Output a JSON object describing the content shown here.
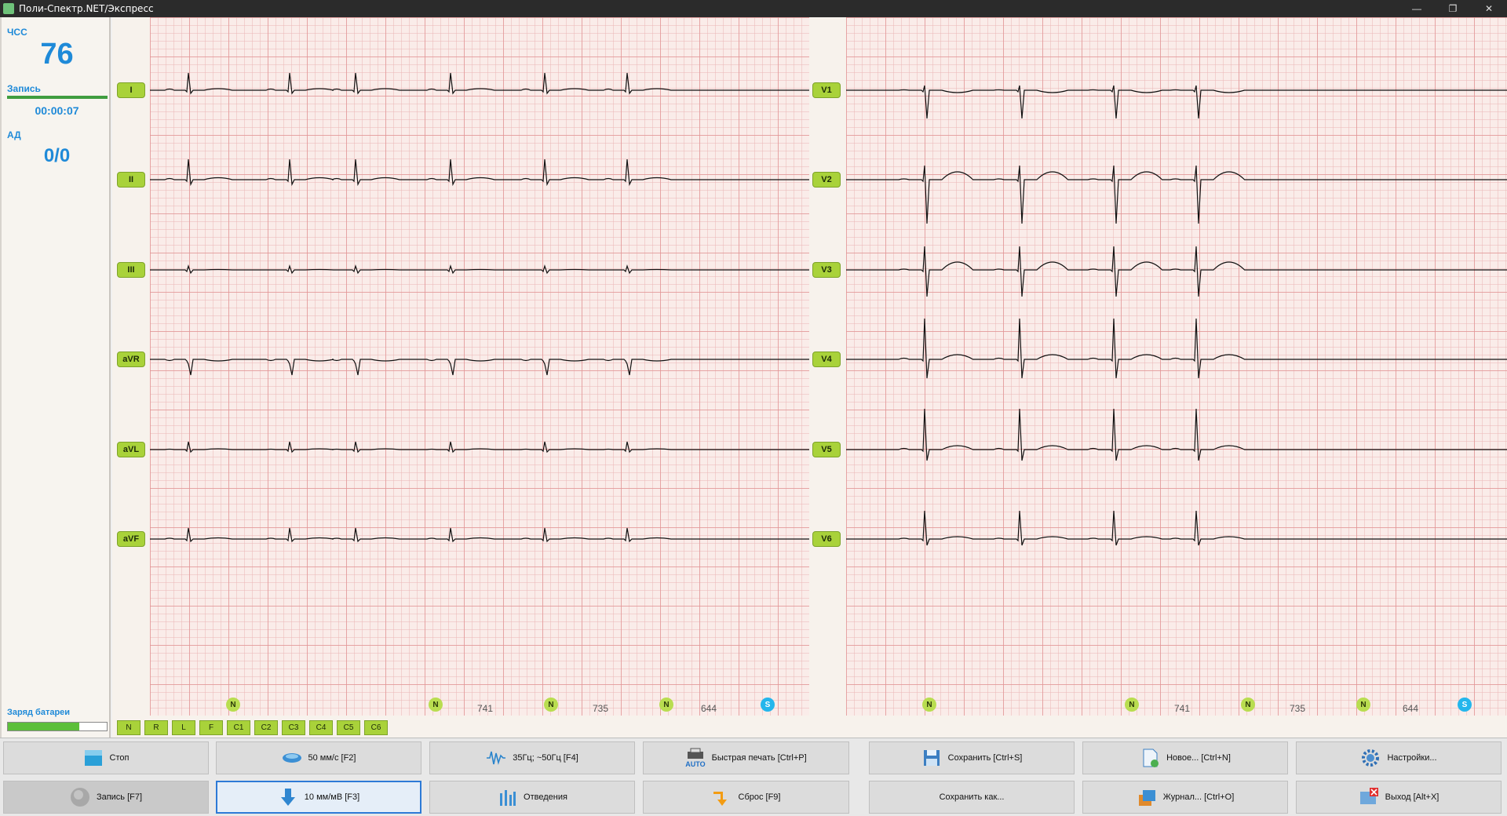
{
  "window": {
    "title": "Поли-Спектр.NET/Экспресс"
  },
  "left_panel": {
    "hr_label": "ЧСС",
    "hr_value": "76",
    "record_label": "Запись",
    "record_progress": 1.0,
    "record_time": "00:00:07",
    "bp_label": "АД",
    "bp_value": "0/0",
    "battery_label": "Заряд батареи",
    "battery_level": 0.72
  },
  "leads_left": [
    "I",
    "II",
    "III",
    "aVR",
    "aVL",
    "aVF"
  ],
  "leads_right": [
    "V1",
    "V2",
    "V3",
    "V4",
    "V5",
    "V6"
  ],
  "beats": [
    "N",
    "N",
    "N",
    "N",
    "S"
  ],
  "rr_intervals": [
    "741",
    "735",
    "644"
  ],
  "electrodes": [
    "N",
    "R",
    "L",
    "F",
    "C1",
    "C2",
    "C3",
    "C4",
    "C5",
    "C6"
  ],
  "toolbar": {
    "stop": "Стоп",
    "speed": "50 мм/с [F2]",
    "filter": "35Гц; ~50Гц [F4]",
    "quick_print": "Быстрая печать [Ctrl+P]",
    "auto_label": "AUTO",
    "save": "Сохранить [Ctrl+S]",
    "new": "Новое... [Ctrl+N]",
    "settings": "Настройки...",
    "record": "Запись [F7]",
    "gain": "10 мм/мВ [F3]",
    "leads": "Отведения",
    "reset": "Сброс [F9]",
    "save_as": "Сохранить как...",
    "journal": "Журнал... [Ctrl+O]",
    "exit": "Выход [Alt+X]"
  },
  "colors": {
    "accent": "#1f8ad8",
    "lead_badge": "#a9d23a",
    "beat_s": "#24b6ec",
    "trace": "#111111"
  }
}
